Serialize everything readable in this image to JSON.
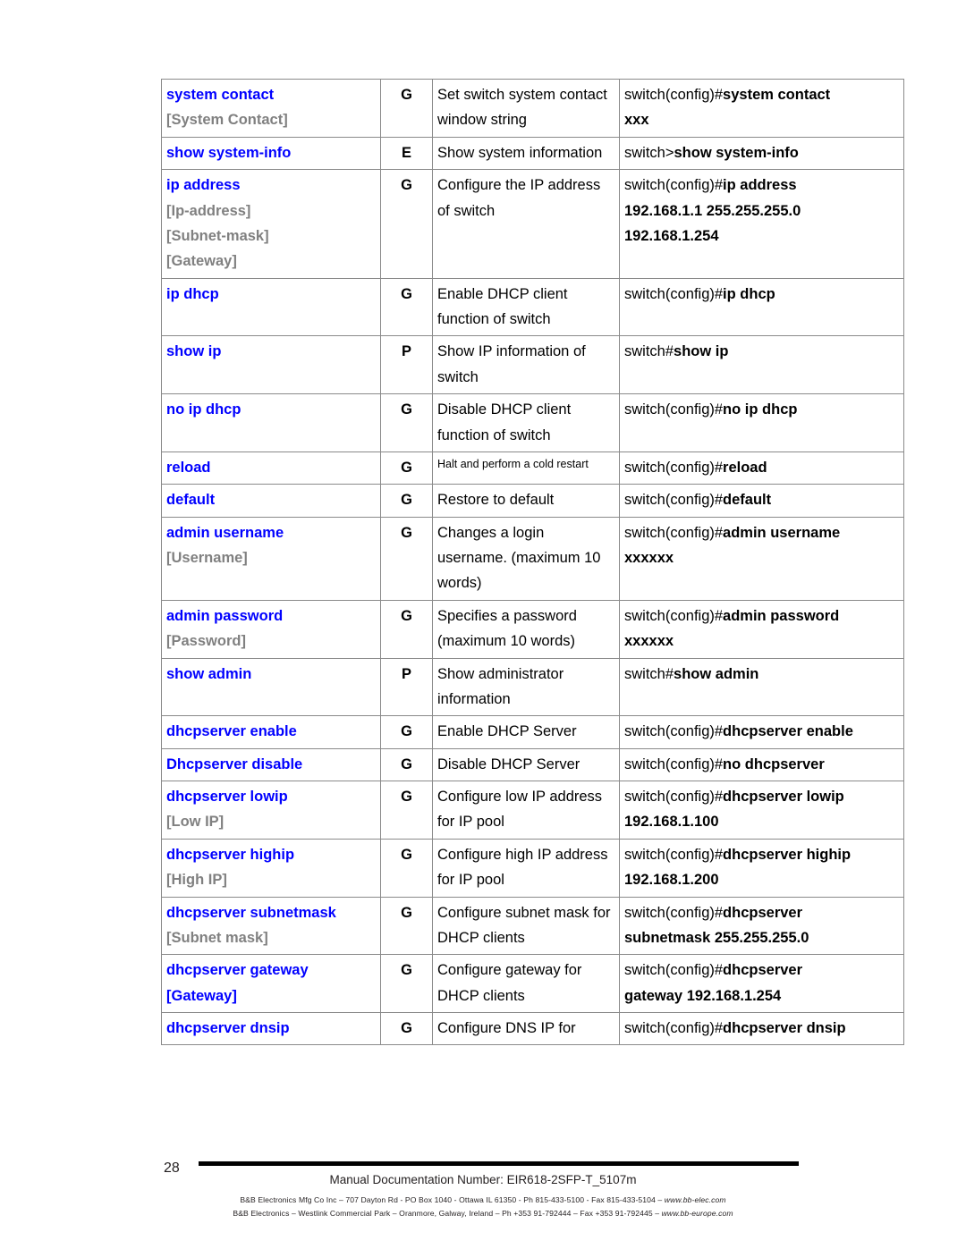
{
  "table": {
    "rows": [
      {
        "command": "system contact",
        "params": [
          {
            "text": "[System Contact]",
            "style": "gray"
          }
        ],
        "mode": "G",
        "description": "Set switch system contact window string",
        "description_small": false,
        "example_prompt": "switch(config)#",
        "example_command": "system contact",
        "example_value": "xxx"
      },
      {
        "command": "show system-info",
        "params": [],
        "mode": "E",
        "description": "Show system information",
        "description_small": false,
        "example_prompt": "switch>",
        "example_command": "show system-info",
        "example_value": ""
      },
      {
        "command": "ip address",
        "params": [
          {
            "text": "[Ip-address]",
            "style": "gray"
          },
          {
            "text": "[Subnet-mask]",
            "style": "gray"
          },
          {
            "text": "[Gateway]",
            "style": "gray"
          }
        ],
        "mode": "G",
        "description": "Configure the IP address of switch",
        "description_small": false,
        "example_prompt": "switch(config)#",
        "example_command": "ip address",
        "example_value": "192.168.1.1 255.255.255.0",
        "example_value2": "192.168.1.254"
      },
      {
        "command": "ip dhcp",
        "params": [],
        "mode": "G",
        "description": "Enable DHCP client function of switch",
        "description_small": false,
        "example_prompt": "switch(config)#",
        "example_command": "ip dhcp",
        "example_value": ""
      },
      {
        "command": "show ip",
        "params": [],
        "mode": "P",
        "description": "Show IP information of switch",
        "description_small": false,
        "example_prompt": "switch#",
        "example_command": "show ip",
        "example_value": ""
      },
      {
        "command": "no ip dhcp",
        "params": [],
        "mode": "G",
        "description": "Disable DHCP client function of switch",
        "description_small": false,
        "example_prompt": "switch(config)#",
        "example_command": "no ip dhcp",
        "example_value": ""
      },
      {
        "command": "reload",
        "params": [],
        "mode": "G",
        "description": "Halt and perform a cold restart",
        "description_small": true,
        "example_prompt": "switch(config)#",
        "example_command": "reload",
        "example_value": ""
      },
      {
        "command": "default",
        "params": [],
        "mode": "G",
        "description": "Restore to default",
        "description_small": false,
        "example_prompt": "switch(config)#",
        "example_command": "default",
        "example_value": ""
      },
      {
        "command": "admin username",
        "params": [
          {
            "text": "[Username]",
            "style": "gray"
          }
        ],
        "mode": "G",
        "description": "Changes a login username. (maximum 10 words)",
        "description_small": false,
        "example_prompt": "switch(config)#",
        "example_command": "admin username",
        "example_value": "xxxxxx"
      },
      {
        "command": "admin password",
        "params": [
          {
            "text": "[Password]",
            "style": "gray"
          }
        ],
        "mode": "G",
        "description": "Specifies a password (maximum 10 words)",
        "description_small": false,
        "example_prompt": "switch(config)#",
        "example_command": "admin password",
        "example_value": "xxxxxx"
      },
      {
        "command": "show admin",
        "params": [],
        "mode": "P",
        "description": "Show administrator information",
        "description_small": false,
        "example_prompt": "switch#",
        "example_command": "show admin",
        "example_value": ""
      },
      {
        "command": "dhcpserver enable",
        "params": [],
        "mode": "G",
        "description": "Enable DHCP Server",
        "description_small": false,
        "example_prompt": "switch(config)#",
        "example_command": "dhcpserver enable",
        "example_value": ""
      },
      {
        "command": "Dhcpserver disable",
        "params": [],
        "mode": "G",
        "description": "Disable DHCP Server",
        "description_small": false,
        "example_prompt": "switch(config)#",
        "example_command": "no dhcpserver",
        "example_value": ""
      },
      {
        "command": "dhcpserver lowip",
        "params": [
          {
            "text": "[Low IP]",
            "style": "gray"
          }
        ],
        "mode": "G",
        "description": "Configure low IP address for IP pool",
        "description_small": false,
        "example_prompt": "switch(config)#",
        "example_command": "dhcpserver lowip",
        "example_value": "192.168.1.100"
      },
      {
        "command": "dhcpserver highip",
        "params": [
          {
            "text": "[High IP]",
            "style": "gray"
          }
        ],
        "mode": "G",
        "description": "Configure high IP address for IP pool",
        "description_small": false,
        "example_prompt": "switch(config)#",
        "example_command": "dhcpserver highip",
        "example_value": "192.168.1.200"
      },
      {
        "command": "dhcpserver subnetmask",
        "params": [
          {
            "text": "[Subnet mask]",
            "style": "gray"
          }
        ],
        "mode": "G",
        "description": "Configure subnet mask for DHCP clients",
        "description_small": false,
        "example_prompt": "switch(config)#",
        "example_command": "dhcpserver",
        "example_value": "subnetmask 255.255.255.0"
      },
      {
        "command": "dhcpserver gateway",
        "params": [
          {
            "text": "[Gateway]",
            "style": "blue"
          }
        ],
        "mode": "G",
        "description": "Configure gateway for DHCP clients",
        "description_small": false,
        "example_prompt": "switch(config)#",
        "example_command": "dhcpserver",
        "example_value": "gateway 192.168.1.254"
      },
      {
        "command": "dhcpserver dnsip",
        "params": [],
        "mode": "G",
        "description": "Configure DNS IP for",
        "description_small": false,
        "example_prompt": "switch(config)#",
        "example_command": "dhcpserver dnsip",
        "example_value": ""
      }
    ]
  },
  "footer": {
    "page_number": "28",
    "manual_line": "Manual Documentation Number: EIR618-2SFP-T_5107m",
    "address_us": "B&B Electronics Mfg Co Inc – 707 Dayton Rd - PO Box 1040 - Ottawa IL 61350 - Ph 815-433-5100 - Fax 815-433-5104 – ",
    "site_us": "www.bb-elec.com",
    "address_eu": "B&B Electronics – Westlink Commercial Park – Oranmore, Galway, Ireland – Ph +353 91-792444 – Fax +353 91-792445 – ",
    "site_eu": "www.bb-europe.com"
  },
  "colors": {
    "command_blue": "#0000ff",
    "param_gray": "#808080",
    "border": "#8a8a8a"
  }
}
